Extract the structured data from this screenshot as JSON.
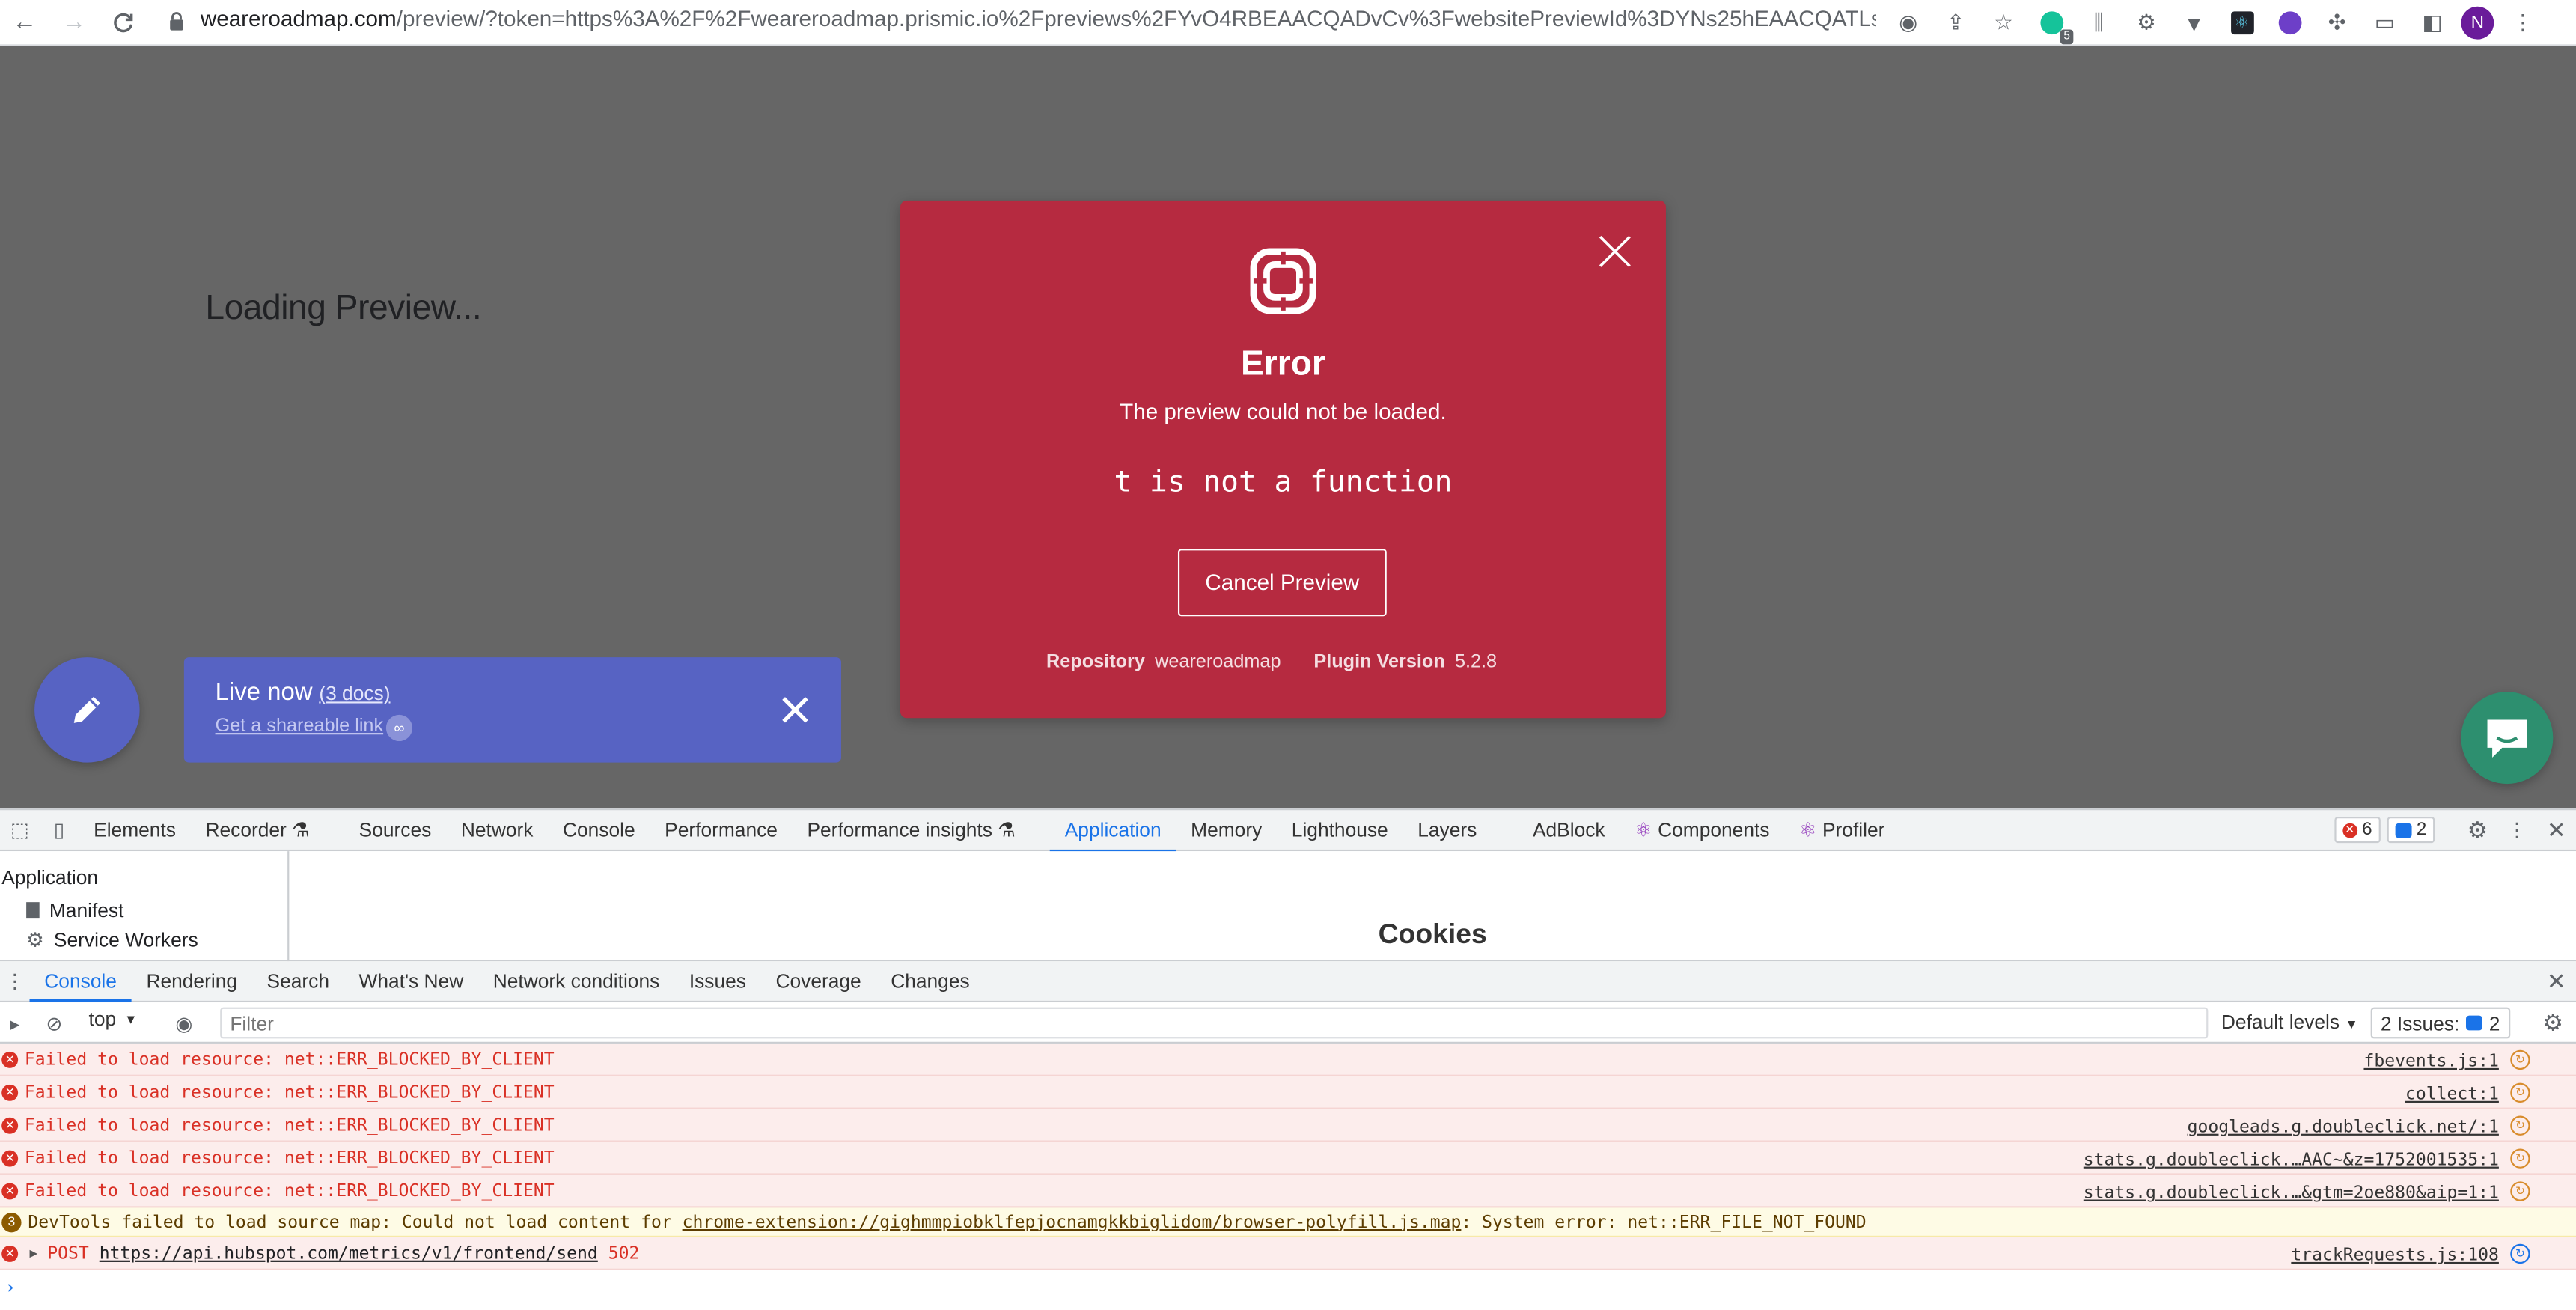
{
  "browser": {
    "url_host": "weareroadmap.com",
    "url_rest": "/preview/?token=https%3A%2F%2Fweareroadmap.prismic.io%2Fpreviews%2FYvO4RBEAACQADvCv%3FwebsitePreviewId%3DYNs25hEAACQATLs...",
    "extension_badge": "5",
    "avatar_initial": "N"
  },
  "page": {
    "loading_text": "Loading Preview..."
  },
  "modal": {
    "title": "Error",
    "subtitle": "The preview could not be loaded.",
    "error_code": "t is not a function",
    "cancel_label": "Cancel Preview",
    "repo_key": "Repository",
    "repo_value": "weareroadmap",
    "plugin_key": "Plugin Version",
    "plugin_value": "5.2.8"
  },
  "live_bar": {
    "title": "Live now",
    "docs": "(3 docs)",
    "link": "Get a shareable link"
  },
  "devtools": {
    "tabs": [
      {
        "label": "Elements"
      },
      {
        "label": "Recorder"
      },
      {
        "label": "Sources"
      },
      {
        "label": "Network"
      },
      {
        "label": "Console"
      },
      {
        "label": "Performance"
      },
      {
        "label": "Performance insights"
      },
      {
        "label": "Application"
      },
      {
        "label": "Memory"
      },
      {
        "label": "Lighthouse"
      },
      {
        "label": "Layers"
      },
      {
        "label": "AdBlock"
      },
      {
        "label": "Components"
      },
      {
        "label": "Profiler"
      }
    ],
    "error_count": "6",
    "issue_count": "2",
    "app_sidebar": {
      "header": "Application",
      "items": [
        "Manifest",
        "Service Workers"
      ]
    },
    "main_title": "Cookies",
    "drawer_tabs": [
      "Console",
      "Rendering",
      "Search",
      "What's New",
      "Network conditions",
      "Issues",
      "Coverage",
      "Changes"
    ],
    "console_bar": {
      "context": "top",
      "filter_placeholder": "Filter",
      "levels": "Default levels",
      "issues_label": "2 Issues:",
      "issues_count": "2"
    },
    "log": [
      {
        "msg": "Failed to load resource: net::ERR_BLOCKED_BY_CLIENT",
        "src": "fbevents.js:1"
      },
      {
        "msg": "Failed to load resource: net::ERR_BLOCKED_BY_CLIENT",
        "src": "collect:1"
      },
      {
        "msg": "Failed to load resource: net::ERR_BLOCKED_BY_CLIENT",
        "src": "googleads.g.doubleclick.net/:1"
      },
      {
        "msg": "Failed to load resource: net::ERR_BLOCKED_BY_CLIENT",
        "src": "stats.g.doubleclick.…AAC~&z=1752001535:1"
      },
      {
        "msg": "Failed to load resource: net::ERR_BLOCKED_BY_CLIENT",
        "src": "stats.g.doubleclick.…&gtm=2oe880&aip=1:1"
      }
    ],
    "warning": {
      "count": "3",
      "pre": "DevTools failed to load source map: Could not load content for ",
      "link": "chrome-extension://gighmmpiobklfepjocnamgkkbiglidom/browser-polyfill.js.map",
      "post": ": System error: net::ERR_FILE_NOT_FOUND"
    },
    "post_row": {
      "method": "POST",
      "url": "https://api.hubspot.com/metrics/v1/frontend/send",
      "status": "502",
      "src": "trackRequests.js:108"
    }
  }
}
